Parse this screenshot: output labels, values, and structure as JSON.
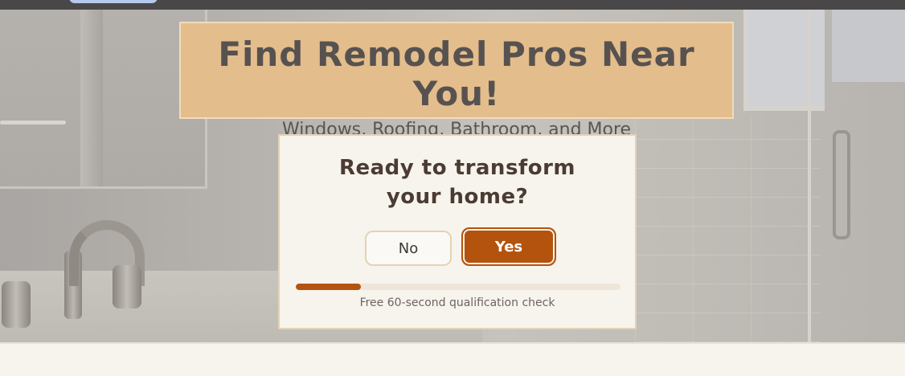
{
  "banner": {
    "title": "Find Remodel Pros Near You!",
    "subtitle": "Windows, Roofing, Bathroom, and More"
  },
  "card": {
    "question": "Ready to transform your home?",
    "buttons": {
      "no_label": "No",
      "yes_label": "Yes"
    },
    "progress": {
      "fraction": 0.2,
      "caption": "Free 60-second qualification check"
    }
  },
  "colors": {
    "accent": "#b4530d",
    "banner_bg": "#e4bd8c",
    "card_bg": "#f7f3ed",
    "topbar": "#4a4748"
  }
}
